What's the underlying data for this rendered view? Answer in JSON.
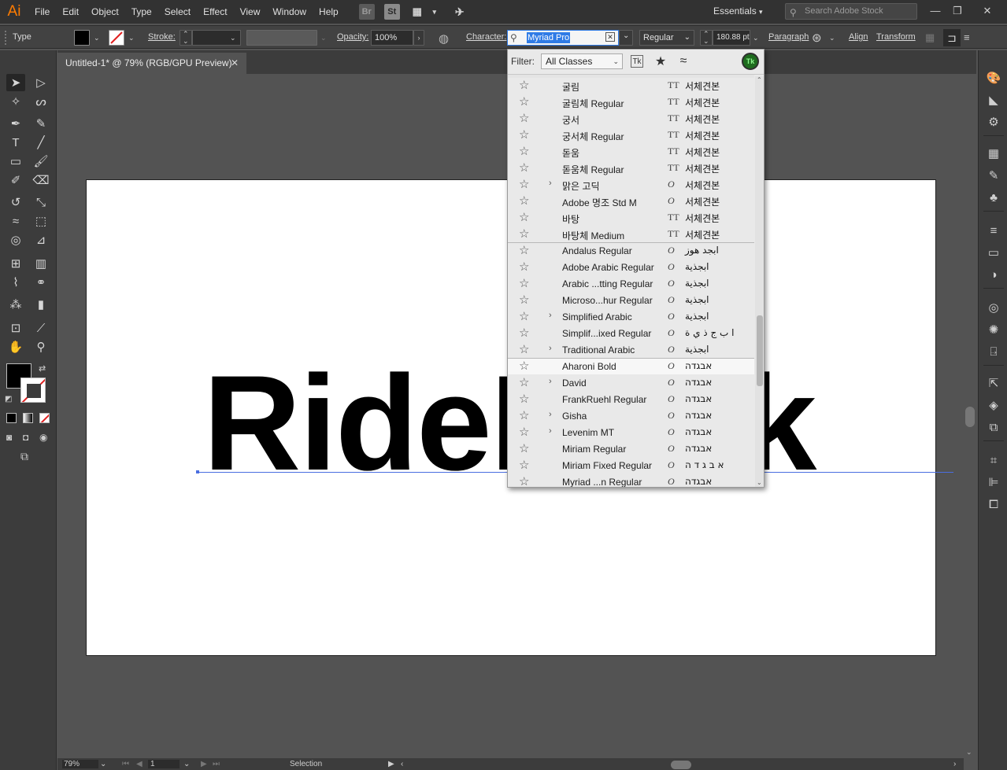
{
  "app": {
    "logo": "Ai",
    "menus": [
      "File",
      "Edit",
      "Object",
      "Type",
      "Select",
      "Effect",
      "View",
      "Window",
      "Help"
    ],
    "bridge_icon": "Br",
    "stock_icon": "St",
    "workspace": "Essentials",
    "stock_search_placeholder": "Search Adobe Stock"
  },
  "control_bar": {
    "mode_label": "Type",
    "stroke_label": "Stroke:",
    "opacity_label": "Opacity:",
    "opacity_value": "100%",
    "character_label": "Character:",
    "font_family": "Myriad Pro",
    "font_style": "Regular",
    "font_size": "180.88 pt",
    "paragraph_label": "Paragraph",
    "align_label": "Align",
    "transform_label": "Transform"
  },
  "document": {
    "tab_title": "Untitled-1* @ 79% (RGB/GPU Preview)",
    "art_text": "RideBuck"
  },
  "font_menu": {
    "filter_label": "Filter:",
    "filter_value": "All Classes",
    "typekit_badge": "Tk",
    "fonts": [
      {
        "name": "굴림",
        "type": "TT",
        "sample": "서체견본",
        "expand": false
      },
      {
        "name": "굴림체 Regular",
        "type": "TT",
        "sample": "서체견본",
        "expand": false
      },
      {
        "name": "궁서",
        "type": "TT",
        "sample": "서체견본",
        "expand": false
      },
      {
        "name": "궁서체 Regular",
        "type": "TT",
        "sample": "서체견본",
        "expand": false
      },
      {
        "name": "돋움",
        "type": "TT",
        "sample": "서체견본",
        "expand": false
      },
      {
        "name": "돋움체 Regular",
        "type": "TT",
        "sample": "서체견본",
        "expand": false
      },
      {
        "name": "맑은 고딕",
        "type": "O",
        "sample": "서체견본",
        "expand": true
      },
      {
        "name": "Adobe 명조 Std M",
        "type": "O",
        "sample": "서체견본",
        "expand": false
      },
      {
        "name": "바탕",
        "type": "TT",
        "sample": "서체견본",
        "expand": false
      },
      {
        "name": "바탕체 Medium",
        "type": "TT",
        "sample": "서체견본",
        "expand": false
      },
      {
        "name": "Andalus Regular",
        "type": "O",
        "sample": "ابجد هوز",
        "expand": false
      },
      {
        "name": "Adobe Arabic Regular",
        "type": "O",
        "sample": "ابجذية",
        "expand": false
      },
      {
        "name": "Arabic ...tting Regular",
        "type": "O",
        "sample": "ابجذية",
        "expand": false
      },
      {
        "name": "Microso...hur Regular",
        "type": "O",
        "sample": "ابجذية",
        "expand": false
      },
      {
        "name": "Simplified Arabic",
        "type": "O",
        "sample": "ابجذية",
        "expand": true
      },
      {
        "name": "Simplif...ixed Regular",
        "type": "O",
        "sample": "ا ب ج ذ ي ة",
        "expand": false
      },
      {
        "name": "Traditional Arabic",
        "type": "O",
        "sample": "ابجذية",
        "expand": true
      },
      {
        "name": "Aharoni Bold",
        "type": "O",
        "sample": "אבגדה",
        "expand": false
      },
      {
        "name": "David",
        "type": "O",
        "sample": "אבגדה",
        "expand": true
      },
      {
        "name": "FrankRuehl Regular",
        "type": "O",
        "sample": "אבגדה",
        "expand": false
      },
      {
        "name": "Gisha",
        "type": "O",
        "sample": "אבגדה",
        "expand": true
      },
      {
        "name": "Levenim MT",
        "type": "O",
        "sample": "אבגדה",
        "expand": true
      },
      {
        "name": "Miriam Regular",
        "type": "O",
        "sample": "אבגדה",
        "expand": false
      },
      {
        "name": "Miriam Fixed Regular",
        "type": "O",
        "sample": "א ב ג ד ה",
        "expand": false
      },
      {
        "name": "Myriad ...n Regular",
        "type": "O",
        "sample": "אבגדה",
        "expand": false
      }
    ]
  },
  "status": {
    "zoom": "79%",
    "artboard_num": "1",
    "tool_name": "Selection"
  },
  "colors": {
    "accent": "#ff7c00",
    "selection_blue": "#4a6ee0",
    "fill": "#000000"
  }
}
